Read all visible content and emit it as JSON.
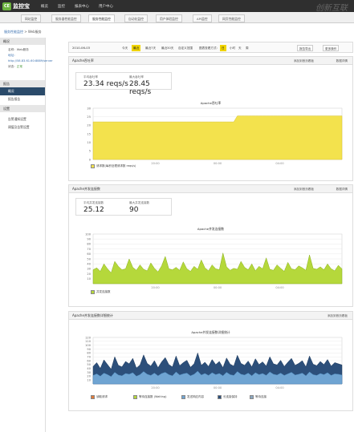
{
  "app": {
    "name": "监控宝",
    "logo_letters": "CE",
    "watermark": "创新互联"
  },
  "topnav": [
    "概览",
    "监控",
    "报表中心",
    "用户中心"
  ],
  "subnav": {
    "tabs": [
      "网站监控",
      "服务器性能监控",
      "服务性能监控",
      "自动化监控",
      "用户体验监控",
      "API监控",
      "网页性能监控"
    ],
    "active_index": 2
  },
  "breadcrumb": {
    "parent": "服务性能监控",
    "sep": " > ",
    "current": "Web服务"
  },
  "sidebar": {
    "overview_title": "概况",
    "name_line": "名称：Web服务",
    "addr_line": "地址：http://58.83.61.60:8889/server",
    "status_label": "状态：",
    "status_value": "正常",
    "reports_title": "报告",
    "reports": [
      "概况",
      "报告报告"
    ],
    "settings_title": "设置",
    "settings": [
      "告警通知设置",
      "阈值及告警设置"
    ]
  },
  "toolbar": {
    "date": "2010-06-03",
    "ranges": [
      "今天",
      "最近",
      "最近7天",
      "最近30天",
      "自定义范围"
    ],
    "compare_label": "图表查看方式：",
    "modes": [
      "日",
      "小时",
      "天",
      "周"
    ],
    "btn_export": "报告导出",
    "btn_more": "更多操作"
  },
  "panels": [
    {
      "title": "Apache吞吐率",
      "link1": "添加到首页看板",
      "link2": "数据详情",
      "stats": [
        {
          "label": "平均吞吐率",
          "value": "23.34 reqs/s"
        },
        {
          "label": "最大吞吐率",
          "value": "28.45 reqs/s"
        }
      ],
      "chart_title": "Apache吞吐率",
      "legend": [
        "请求数(每秒处理请求数 reqs/s)"
      ]
    },
    {
      "title": "Apache并发连接数",
      "link1": "添加到首页看板",
      "link2": "数据详情",
      "stats": [
        {
          "label": "平均并发连接数",
          "value": "25.12"
        },
        {
          "label": "最大并发连接数",
          "value": "90"
        }
      ],
      "chart_title": "Apache并发连接数",
      "legend": [
        "并发连接数"
      ]
    },
    {
      "title": "Apache并发连接数详细统计",
      "link2": "添加到首页看板",
      "chart_title": "Apache并发连接数详细统计",
      "legend": [
        "读取请求",
        "等待连接数 (Waiting)",
        "发送响应内容",
        "长连接保持",
        "等待连接"
      ]
    }
  ],
  "colors": {
    "yellow": "#f3e24d",
    "green": "#b5d83b",
    "dark_blue": "#2c4f7a",
    "light_blue": "#6fa4d2",
    "accent": "#f0d400"
  },
  "chart_data": [
    {
      "type": "area",
      "title": "Apache吞吐率",
      "ylim": [
        0,
        30
      ],
      "yticks": [
        0,
        5,
        10,
        15,
        20,
        25,
        30
      ],
      "xticks": [
        "20:00",
        "00:00",
        "04:00"
      ],
      "series": [
        {
          "name": "请求数(每秒处理请求数 reqs/s)",
          "values": [
            22,
            22,
            22,
            22,
            22,
            22,
            22,
            22,
            22,
            22,
            22,
            22,
            22,
            22,
            22,
            22,
            22,
            22,
            22,
            22,
            22,
            22,
            22,
            22,
            22,
            22,
            22,
            22,
            22,
            22,
            22,
            22,
            22,
            22,
            22,
            22,
            22,
            22,
            22,
            22,
            25.5,
            25.5,
            25.5,
            25.5,
            25.5,
            25.5,
            25.5,
            25.5,
            25.5,
            25.5,
            25.5,
            25.5,
            25.5,
            25.5,
            25.5,
            25.5,
            25.5,
            25.5,
            25.5,
            25.5,
            25.5,
            25.5,
            25.5,
            25.5,
            25.5,
            25.5,
            25.5,
            25.5,
            25.5,
            25.5
          ]
        }
      ]
    },
    {
      "type": "area",
      "title": "Apache并发连接数",
      "ylim": [
        0,
        100
      ],
      "yticks": [
        10,
        20,
        30,
        40,
        50,
        60,
        70,
        80,
        90,
        100
      ],
      "xticks": [
        "20:00",
        "00:00",
        "04:00"
      ],
      "series": [
        {
          "name": "并发连接数",
          "values": [
            28,
            32,
            25,
            40,
            30,
            22,
            45,
            35,
            28,
            30,
            50,
            33,
            27,
            38,
            29,
            26,
            42,
            31,
            24,
            36,
            55,
            30,
            28,
            33,
            27,
            44,
            30,
            25,
            35,
            29,
            48,
            32,
            26,
            38,
            30,
            28,
            62,
            34,
            27,
            31,
            29,
            45,
            33,
            28,
            40,
            26,
            35,
            30,
            52,
            29,
            27,
            38,
            31,
            25,
            43,
            30,
            28,
            36,
            32,
            27,
            58,
            31,
            29,
            34,
            28,
            40,
            30,
            26,
            37,
            30
          ]
        }
      ]
    },
    {
      "type": "area",
      "title": "Apache并发连接数详细统计",
      "ylim": [
        0,
        120
      ],
      "yticks": [
        10,
        20,
        30,
        40,
        50,
        60,
        70,
        80,
        90,
        100,
        110,
        120
      ],
      "xticks": [
        "20:00",
        "00:00",
        "04:00"
      ],
      "series": [
        {
          "name": "等待连接数 (Waiting)",
          "values": [
            45,
            55,
            40,
            62,
            50,
            38,
            70,
            48,
            44,
            58,
            52,
            66,
            41,
            49,
            75,
            53,
            46,
            60,
            42,
            57,
            68,
            50,
            44,
            72,
            47,
            55,
            61,
            43,
            52,
            80,
            48,
            56,
            45,
            63,
            50,
            58,
            42,
            67,
            51,
            46,
            74,
            53,
            48,
            59,
            44,
            65,
            50,
            57,
            46,
            70,
            52,
            49,
            61,
            45,
            56,
            66,
            48,
            53,
            60,
            44,
            72,
            51,
            47,
            58,
            50,
            63,
            46,
            55,
            52,
            49
          ]
        },
        {
          "name": "发送响应内容",
          "values": [
            22,
            26,
            20,
            28,
            24,
            19,
            30,
            23,
            21,
            27,
            25,
            29,
            20,
            24,
            32,
            25,
            22,
            28,
            21,
            27,
            30,
            24,
            21,
            31,
            23,
            26,
            28,
            21,
            25,
            33,
            23,
            27,
            22,
            29,
            24,
            27,
            21,
            30,
            24,
            22,
            32,
            25,
            23,
            28,
            21,
            29,
            24,
            27,
            22,
            31,
            25,
            23,
            28,
            22,
            26,
            30,
            23,
            25,
            28,
            21,
            31,
            24,
            22,
            27,
            24,
            29,
            22,
            26,
            25,
            23
          ]
        }
      ]
    }
  ]
}
